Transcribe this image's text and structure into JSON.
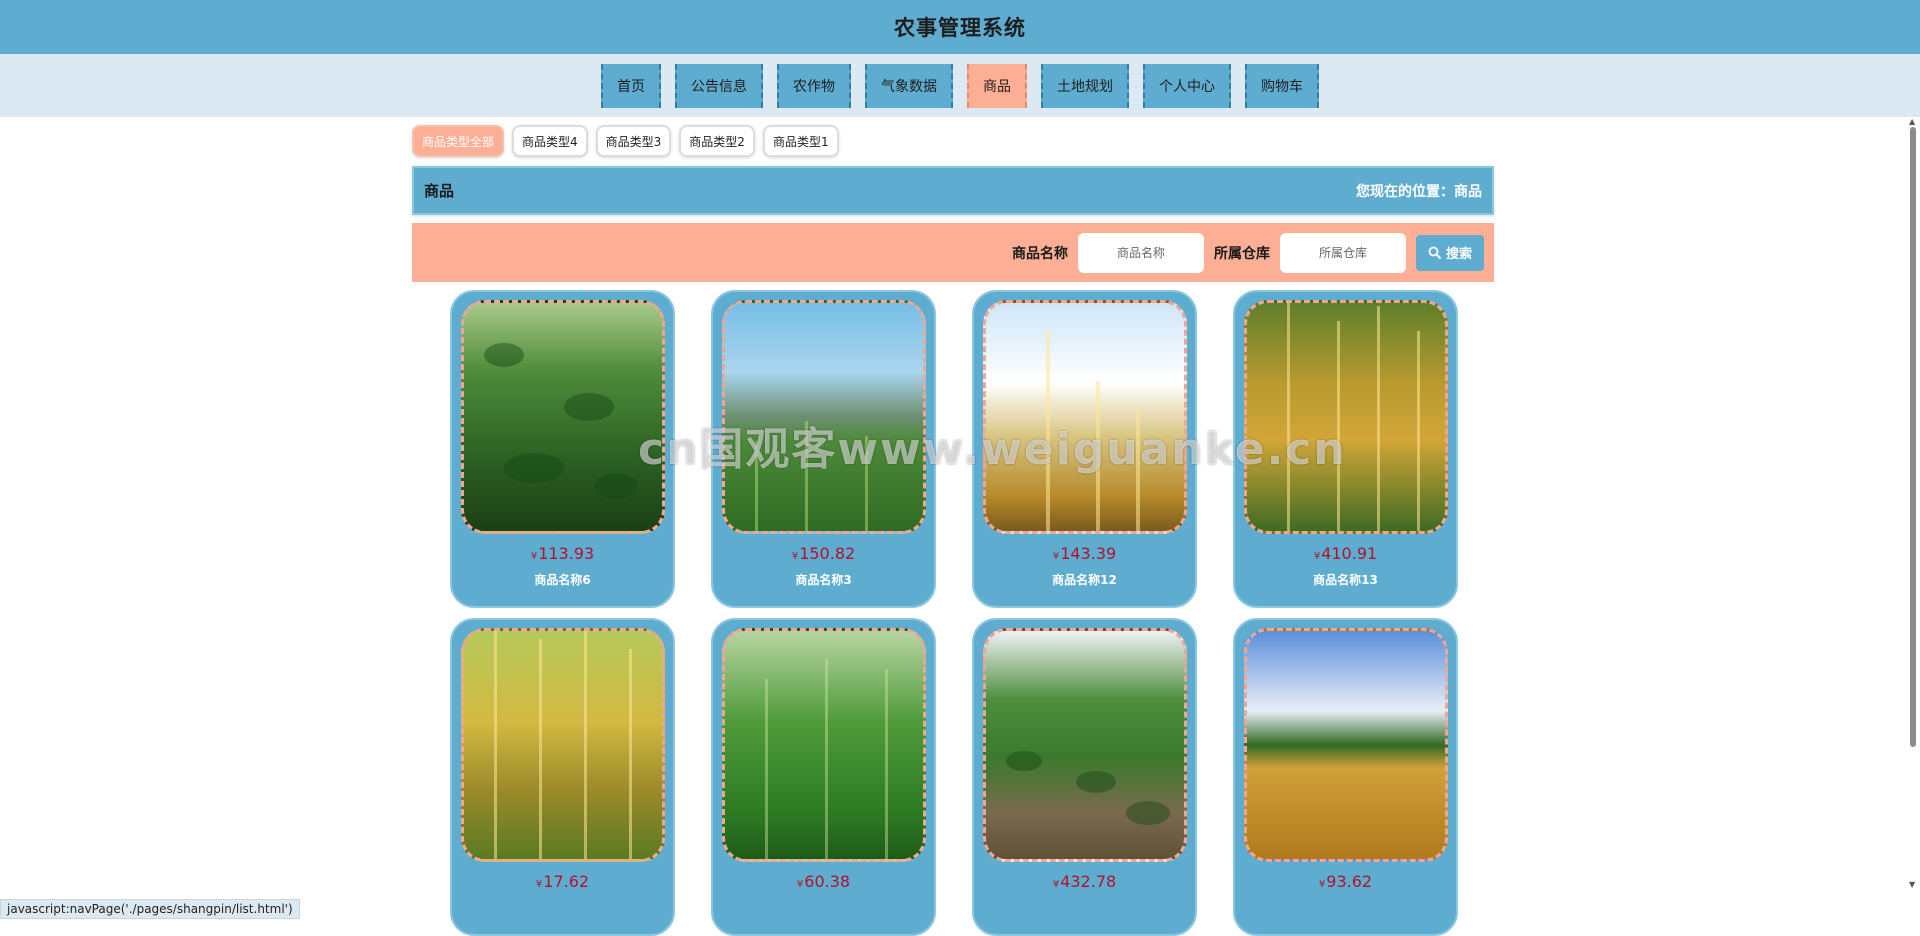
{
  "app": {
    "title": "农事管理系统"
  },
  "nav": {
    "items": [
      {
        "label": "首页"
      },
      {
        "label": "公告信息"
      },
      {
        "label": "农作物"
      },
      {
        "label": "气象数据"
      },
      {
        "label": "商品",
        "active": true
      },
      {
        "label": "土地规划"
      },
      {
        "label": "个人中心"
      },
      {
        "label": "购物车"
      }
    ]
  },
  "type_tabs": [
    {
      "label": "商品类型全部",
      "active": true
    },
    {
      "label": "商品类型4"
    },
    {
      "label": "商品类型3"
    },
    {
      "label": "商品类型2"
    },
    {
      "label": "商品类型1"
    }
  ],
  "breadcrumb": {
    "title": "商品",
    "position_label": "您现在的位置：",
    "position_value": "商品"
  },
  "search": {
    "name_label": "商品名称",
    "name_placeholder": "商品名称",
    "warehouse_label": "所属仓库",
    "warehouse_placeholder": "所属仓库",
    "button_label": "搜索"
  },
  "currency": "¥",
  "products": [
    {
      "price": "113.93",
      "name": "商品名称6",
      "photo": "tea-field"
    },
    {
      "price": "150.82",
      "name": "商品名称3",
      "photo": "green-field-mountains"
    },
    {
      "price": "143.39",
      "name": "商品名称12",
      "photo": "wheat-sky"
    },
    {
      "price": "410.91",
      "name": "商品名称13",
      "photo": "rice-ears"
    },
    {
      "price": "17.62",
      "name": "",
      "photo": "golden-rice"
    },
    {
      "price": "60.38",
      "name": "",
      "photo": "millet"
    },
    {
      "price": "432.78",
      "name": "",
      "photo": "vegetable-field"
    },
    {
      "price": "93.62",
      "name": "",
      "photo": "wheat-field-clouds"
    }
  ],
  "watermark": "cn国观客www.weiguanke.cn",
  "status_bar": "javascript:navPage('./pages/shangpin/list.html')",
  "colors": {
    "primary": "#5eadd1",
    "accent": "#fdaf95",
    "price": "#b4112d",
    "nav_bg": "#dce9f2"
  }
}
